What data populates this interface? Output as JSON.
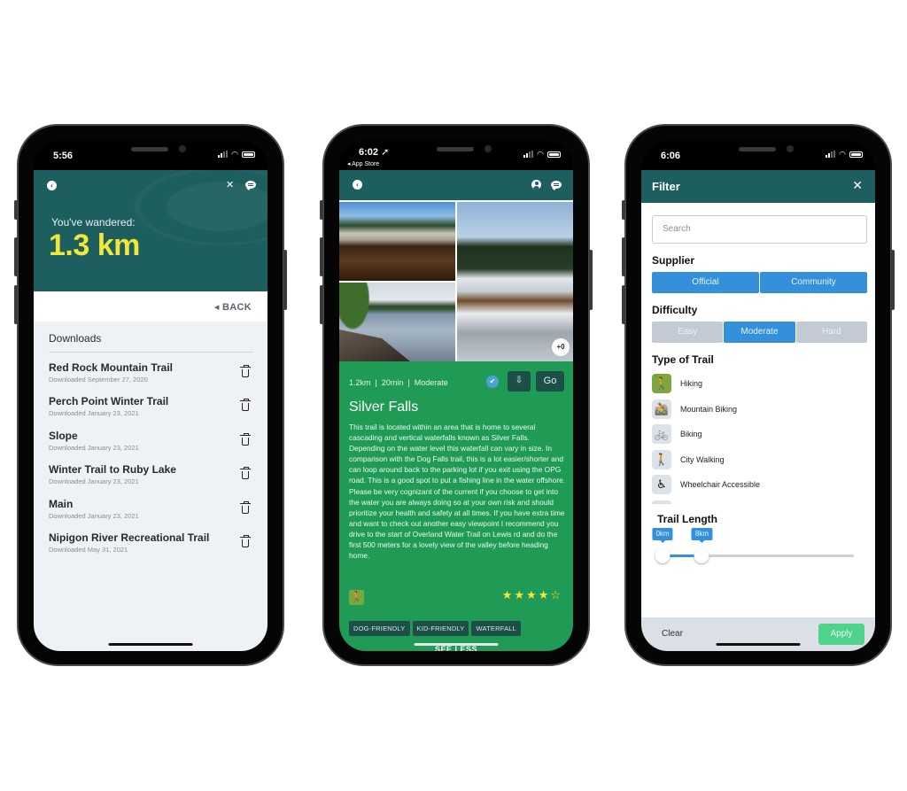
{
  "phones": [
    {
      "status": {
        "time": "5:56"
      },
      "header": {
        "back_icon": "chevron-left-circle-icon",
        "icons": [
          "tools-icon",
          "chat-bubble-icon"
        ],
        "wander_label": "You've wandered:",
        "wander_value": "1.3 km"
      },
      "back_label": "◂ BACK",
      "downloads": {
        "title": "Downloads",
        "items": [
          {
            "name": "Red Rock Mountain Trail",
            "date": "Downloaded September 27, 2020"
          },
          {
            "name": "Perch Point Winter Trail",
            "date": "Downloaded January 23, 2021"
          },
          {
            "name": "Slope",
            "date": "Downloaded January 23, 2021"
          },
          {
            "name": "Winter Trail to Ruby Lake",
            "date": "Downloaded January 23, 2021"
          },
          {
            "name": "Main",
            "date": "Downloaded January 23, 2021"
          },
          {
            "name": "Nipigon River Recreational Trail",
            "date": "Downloaded May 31, 2021"
          }
        ]
      }
    },
    {
      "status": {
        "time": "6:02 ➚",
        "back_app": "◂ App Store"
      },
      "gallery": {
        "more_count": "+0"
      },
      "trail": {
        "meta": "1.2km  |  20min  |  Moderate",
        "verified_icon": "✔",
        "download_icon": "⇩",
        "go_label": "Go",
        "title": "Silver Falls",
        "description": "This trail is located within an area that is home to several cascading and vertical waterfalls known as Silver Falls. Depending on the water level this waterfall can vary in size. In comparison with the Dog Falls trail, this is a lot easier/shorter and can loop around back to the parking lot if you exit using the OPG road. This is a good spot to put a fishing line in the water offshore. Please be very cognizant of the current if you choose to get into the water you are always doing so at your own risk and should prioritize your health and safety at all times. If you have extra time and want to check out another easy viewpoint I recommend you drive to the start of Overland Water Trail on Lewis rd and do the first 500 meters for a lovely view of the valley before heading home.",
        "type_icon": "hiking-icon",
        "rating": 4,
        "rating_max": 5,
        "tags": [
          "DOG-FRIENDLY",
          "KID-FRIENDLY",
          "WATERFALL"
        ],
        "see_less": "SEE LESS"
      }
    },
    {
      "status": {
        "time": "6:06"
      },
      "filter": {
        "title": "Filter",
        "close_icon": "✕",
        "search_placeholder": "Search",
        "supplier": {
          "title": "Supplier",
          "options": [
            "Official",
            "Community"
          ],
          "selected": [
            "Official",
            "Community"
          ]
        },
        "difficulty": {
          "title": "Difficulty",
          "options": [
            "Easy",
            "Moderate",
            "Hard"
          ],
          "selected": [
            "Moderate"
          ]
        },
        "trail_types": {
          "title": "Type of Trail",
          "items": [
            {
              "label": "Hiking",
              "icon": "hiking-icon",
              "glyph": "🚶",
              "active": true
            },
            {
              "label": "Mountain Biking",
              "icon": "mountain-biking-icon",
              "glyph": "🚵",
              "active": false
            },
            {
              "label": "Biking",
              "icon": "biking-icon",
              "glyph": "🚲",
              "active": false
            },
            {
              "label": "City Walking",
              "icon": "walking-icon",
              "glyph": "🚶",
              "active": false
            },
            {
              "label": "Wheelchair Accessible",
              "icon": "wheelchair-icon",
              "glyph": "♿",
              "active": false
            },
            {
              "label": "",
              "icon": "more-icon",
              "glyph": "▭",
              "active": false
            }
          ]
        },
        "trail_length": {
          "title": "Trail Length",
          "min_label": "0km",
          "max_label": "8km",
          "min_value": 0,
          "max_value": 8,
          "range_max": 100
        },
        "clear_label": "Clear",
        "apply_label": "Apply"
      }
    }
  ],
  "colors": {
    "header_teal": "#1d5e5e",
    "wander_yellow": "#f3e63a",
    "trail_green": "#1f9b55",
    "tag_dark": "#1b4f47",
    "accent_blue": "#3590dc",
    "apply_green": "#4fd28c",
    "hiking_green": "#7da63e"
  }
}
